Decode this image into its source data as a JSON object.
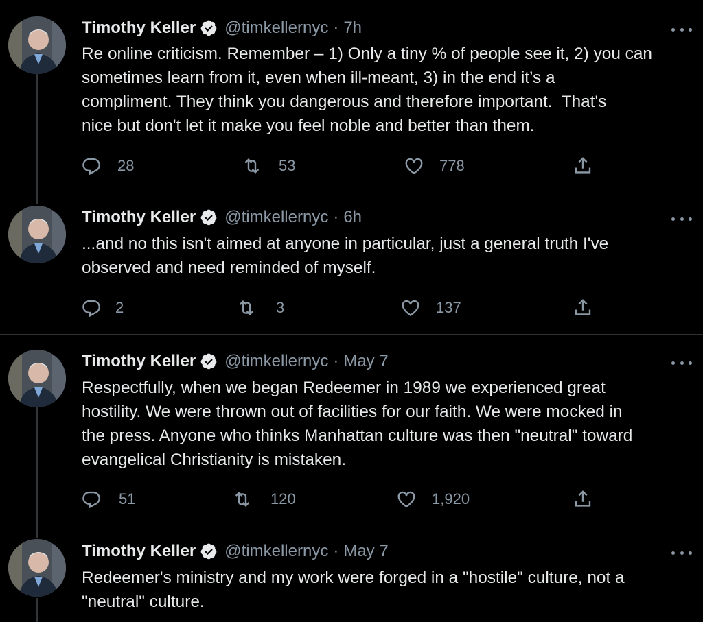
{
  "tweets": [
    {
      "name": "Timothy Keller",
      "handle": "@timkellernyc",
      "dot": "·",
      "time": "7h",
      "text": "Re online criticism. Remember – 1) Only a tiny % of people see it, 2) you can\nsometimes learn from it, even when ill-meant, 3) in the end it’s a\ncompliment. They think you dangerous and therefore important.  That's\nnice but don't let it make you feel noble and better than them.",
      "replies": "28",
      "retweets": "53",
      "likes": "778"
    },
    {
      "name": "Timothy Keller",
      "handle": "@timkellernyc",
      "dot": "·",
      "time": "6h",
      "text": "...and no this isn't aimed at anyone in particular, just a general truth I've\nobserved and need reminded of myself.",
      "replies": "2",
      "retweets": "3",
      "likes": "137"
    },
    {
      "name": "Timothy Keller",
      "handle": "@timkellernyc",
      "dot": "·",
      "time": "May 7",
      "text": "Respectfully, when we began Redeemer in 1989 we experienced great\nhostility. We were thrown out of facilities for our faith. We were mocked in\nthe press. Anyone who thinks Manhattan culture was then \"neutral\" toward\nevangelical Christianity is mistaken.",
      "replies": "51",
      "retweets": "120",
      "likes": "1,920"
    },
    {
      "name": "Timothy Keller",
      "handle": "@timkellernyc",
      "dot": "·",
      "time": "May 7",
      "text": "Redeemer's ministry and my work were forged in a \"hostile\" culture, not a\n\"neutral\" culture."
    }
  ],
  "icons": {
    "verified": "verified-badge-icon",
    "more": "more-dots-icon",
    "reply": "reply-icon",
    "retweet": "retweet-icon",
    "like": "heart-icon",
    "share": "share-icon"
  },
  "colors": {
    "background": "#000000",
    "text": "#e7e9ea",
    "secondary": "#8b98a5",
    "divider": "#2f3336"
  }
}
